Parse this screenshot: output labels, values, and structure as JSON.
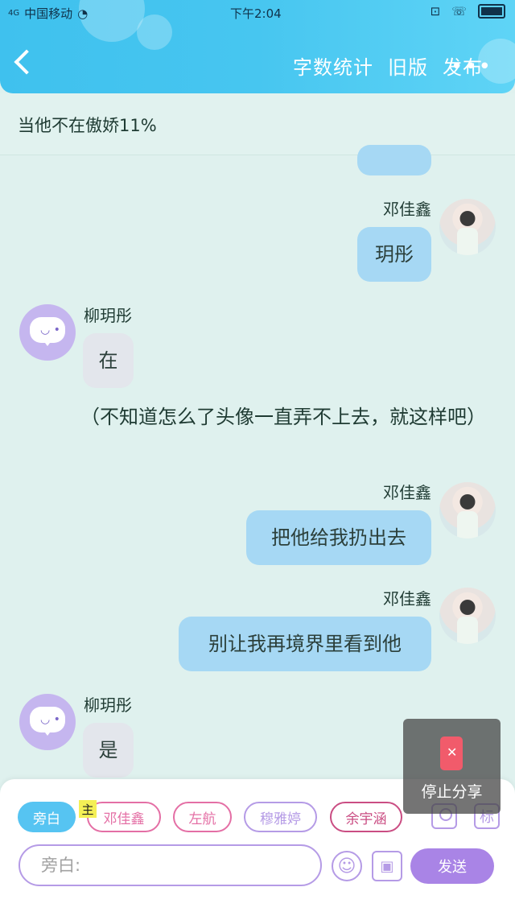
{
  "status_bar": {
    "carrier": "中国移动",
    "network": "4G",
    "time": "下午2:04",
    "icons": [
      "signal-icon",
      "wifi-icon",
      "cast-icon",
      "hd-call-icon",
      "battery-icon"
    ]
  },
  "header": {
    "back_icon": "back-arrow-icon",
    "actions": [
      "字数统计",
      "旧版",
      "发布"
    ],
    "more": "•••",
    "color": "#47c6f0"
  },
  "story": {
    "title": "当他不在傲娇11%"
  },
  "messages": [
    {
      "side": "right",
      "name": "邓佳鑫",
      "text": "玥彤"
    },
    {
      "side": "left",
      "name": "柳玥彤",
      "text": "在"
    },
    {
      "side": "narration",
      "text": "（不知道怎么了头像一直弄不上去，就这样吧）"
    },
    {
      "side": "right",
      "name": "邓佳鑫",
      "text": "把他给我扔出去"
    },
    {
      "side": "right",
      "name": "邓佳鑫",
      "text": "别让我再境界里看到他"
    },
    {
      "side": "left",
      "name": "柳玥彤",
      "text": "是"
    }
  ],
  "composer": {
    "narration_chip": "旁白",
    "main_tag": "主",
    "characters": [
      "邓佳鑫",
      "左航",
      "穆雅婷",
      "余宇涵"
    ],
    "input_placeholder": "旁白:",
    "send_label": "发送",
    "tag_label": "标"
  },
  "overlay": {
    "label": "停止分享"
  }
}
